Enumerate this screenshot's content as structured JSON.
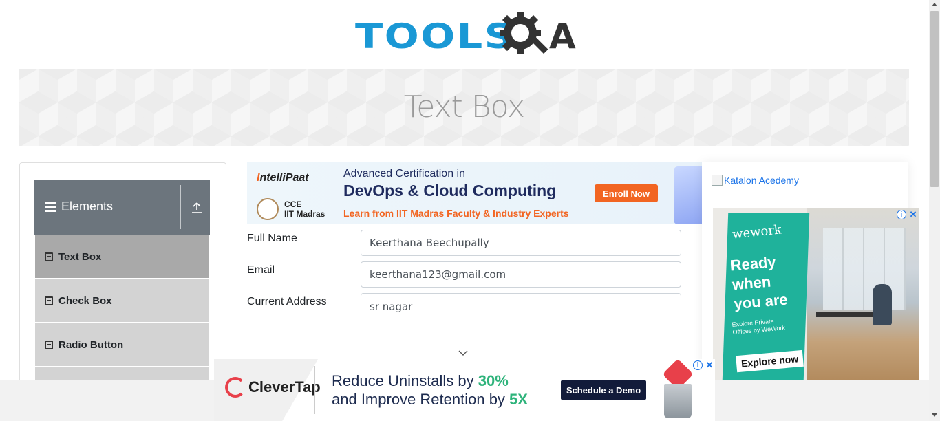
{
  "header": {
    "logo_text_left": "TOOLS",
    "logo_text_right": "A",
    "logo_icon": "gear-magnifier-icon"
  },
  "banner": {
    "title": "Text Box"
  },
  "sidebar": {
    "group_title": "Elements",
    "group_icon": "hamburger-icon",
    "toggle_icon": "collapse-arrow-icon",
    "items": [
      {
        "label": "Text Box",
        "active": true
      },
      {
        "label": "Check Box",
        "active": false
      },
      {
        "label": "Radio Button",
        "active": false
      }
    ]
  },
  "top_ad": {
    "brand": "ntelliPaat",
    "brand_initial": "I",
    "badge_line1": "CCE",
    "badge_line2": "IIT Madras",
    "line1": "Advanced Certification in",
    "line2": "DevOps & Cloud Computing",
    "line3": "Learn from IIT Madras Faculty & Industry Experts",
    "cta": "Enroll Now"
  },
  "form": {
    "full_name_label": "Full Name",
    "full_name_value": "Keerthana Beechupally",
    "email_label": "Email",
    "email_value": "keerthana123@gmail.com",
    "address_label": "Current Address",
    "address_value": "sr nagar"
  },
  "right_ad": {
    "broken_image_alt": "Katalon Acedemy",
    "wework_logo": "wework",
    "wework_headline_1": "Ready",
    "wework_headline_2": "when",
    "wework_headline_3": "you are",
    "wework_sub": "Explore Private Offices by WeWork",
    "wework_cta": "Explore now"
  },
  "bottom_ad": {
    "brand": "CleverTap",
    "line1_prefix": "Reduce Uninstalls by ",
    "line1_highlight": "30%",
    "line2_prefix": "and Improve Retention by ",
    "line2_highlight": "5X",
    "cta": "Schedule a Demo"
  },
  "ad_controls": {
    "info_glyph": "i",
    "close_glyph": "✕"
  },
  "colors": {
    "brand_blue": "#1a98d5",
    "menu_header": "#6c757d",
    "menu_active": "#a9a9a9",
    "menu_item": "#d3d3d3"
  }
}
